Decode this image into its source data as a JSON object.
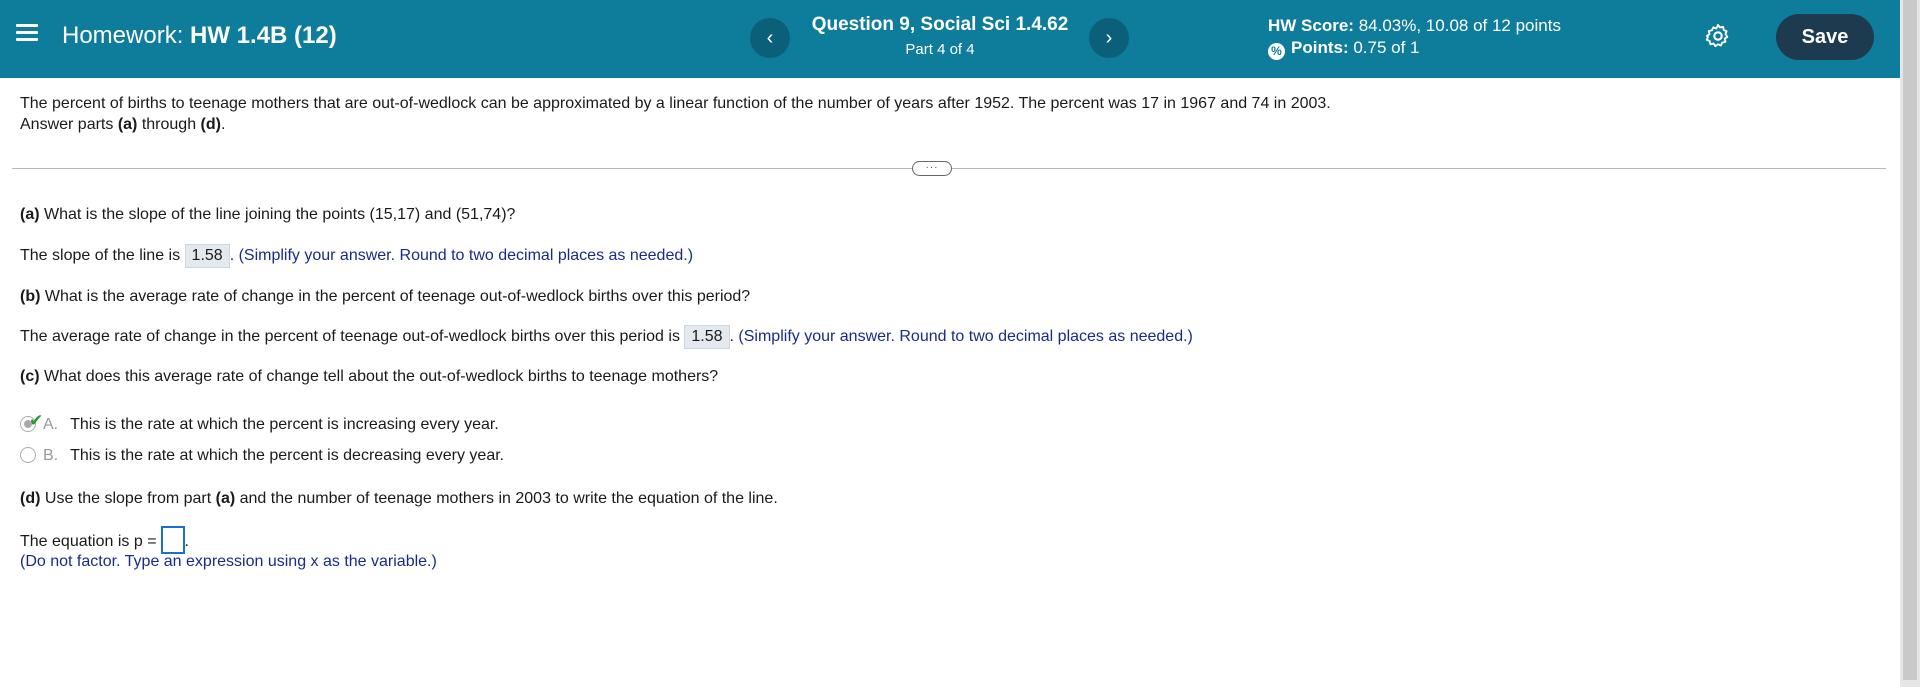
{
  "header": {
    "title_prefix": "Homework:",
    "title_hw": "HW 1.4B (12)",
    "question_title": "Question 9, Social Sci 1.4.62",
    "question_part": "Part 4 of 4",
    "prev_label": "‹",
    "next_label": "›",
    "score_label": "HW Score:",
    "score_value": "84.03%, 10.08 of 12 points",
    "points_label": "Points:",
    "points_value": "0.75 of 1",
    "points_icon": "partial-credit-icon",
    "save_label": "Save",
    "colors": {
      "bar": "#0e7c9b",
      "save": "#1e3a4e"
    }
  },
  "intro": {
    "line1": "The percent of births to teenage mothers that are out-of-wedlock can be approximated by a linear function of the number of years after 1952. The percent was 17 in 1967 and 74 in 2003.",
    "line2_pre": "Answer parts ",
    "a": "(a)",
    "line2_mid": " through ",
    "d": "(d)",
    "line2_end": "."
  },
  "divider_handle": "···",
  "part_a": {
    "label": "(a)",
    "question": " What is the slope of the line joining the points (15,17) and (51,74)?",
    "answer_pre": "The slope of the line is ",
    "answer_value": "1.58",
    "answer_post": ". ",
    "hint": "(Simplify your answer. Round to two decimal places as needed.)"
  },
  "part_b": {
    "label": "(b)",
    "question": " What is the average rate of change in the percent of teenage out-of-wedlock births over this period?",
    "answer_pre": "The average rate of change in the percent of teenage out-of-wedlock births over this period is ",
    "answer_value": "1.58",
    "answer_post": ". ",
    "hint": "(Simplify your answer. Round to two decimal places as needed.)"
  },
  "part_c": {
    "label": "(c)",
    "question": " What does this average rate of change tell about the out-of-wedlock births to teenage mothers?",
    "choices": [
      {
        "letter": "A.",
        "text": "This is the rate at which the percent is increasing every year.",
        "selected": true
      },
      {
        "letter": "B.",
        "text": "This is the rate at which the percent is decreasing every year.",
        "selected": false
      }
    ]
  },
  "part_d": {
    "label": "(d)",
    "question_pre": " Use the slope from part ",
    "question_ref": "(a)",
    "question_post": " and the number of teenage mothers in 2003 to write the equation of the line.",
    "answer_pre": "The equation is p =",
    "answer_post": ".",
    "hint": "(Do not factor. Type an expression using x as the variable.)"
  }
}
